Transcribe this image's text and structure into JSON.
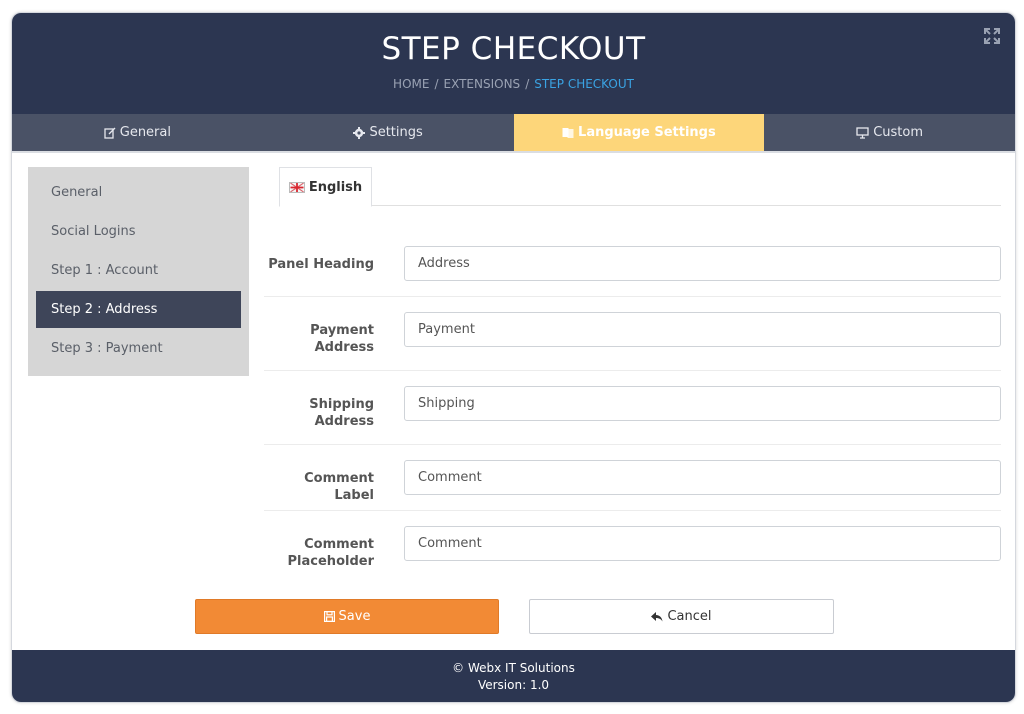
{
  "header": {
    "title": "STEP CHECKOUT",
    "breadcrumb": [
      {
        "label": "HOME"
      },
      {
        "label": "EXTENSIONS"
      },
      {
        "label": "STEP CHECKOUT"
      }
    ],
    "separator": "/",
    "expand_icon": "expand-icon"
  },
  "tabs": [
    {
      "label": "General",
      "icon": "edit-icon"
    },
    {
      "label": "Settings",
      "icon": "gear-icon"
    },
    {
      "label": "Language Settings",
      "icon": "language-icon",
      "active": true
    },
    {
      "label": "Custom",
      "icon": "monitor-icon"
    }
  ],
  "sidebar": {
    "items": [
      {
        "label": "General"
      },
      {
        "label": "Social Logins"
      },
      {
        "label": "Step 1 : Account"
      },
      {
        "label": "Step 2 : Address",
        "active": true
      },
      {
        "label": "Step 3 : Payment"
      }
    ]
  },
  "language_tab": {
    "label": "English",
    "icon": "uk-flag-icon"
  },
  "form": {
    "fields": [
      {
        "label": "Panel Heading",
        "value": "Address"
      },
      {
        "label": "Payment Address",
        "value": "Payment"
      },
      {
        "label": "Shipping Address",
        "value": "Shipping"
      },
      {
        "label": "Comment Label",
        "value": "Comment"
      },
      {
        "label": "Comment Placeholder",
        "value": "Comment"
      }
    ]
  },
  "buttons": {
    "save_label": "Save",
    "cancel_label": "Cancel"
  },
  "footer": {
    "copyright": "© Webx IT Solutions",
    "version": "Version: 1.0"
  },
  "colors": {
    "header_bg": "#2c3651",
    "tab_bar_bg": "#4a5266",
    "active_tab_bg": "#fdd67a",
    "sidebar_bg": "#d6d6d6",
    "sidebar_active_bg": "#3e4559",
    "save_button": "#f28a35",
    "breadcrumb_active": "#3aa3e3"
  }
}
